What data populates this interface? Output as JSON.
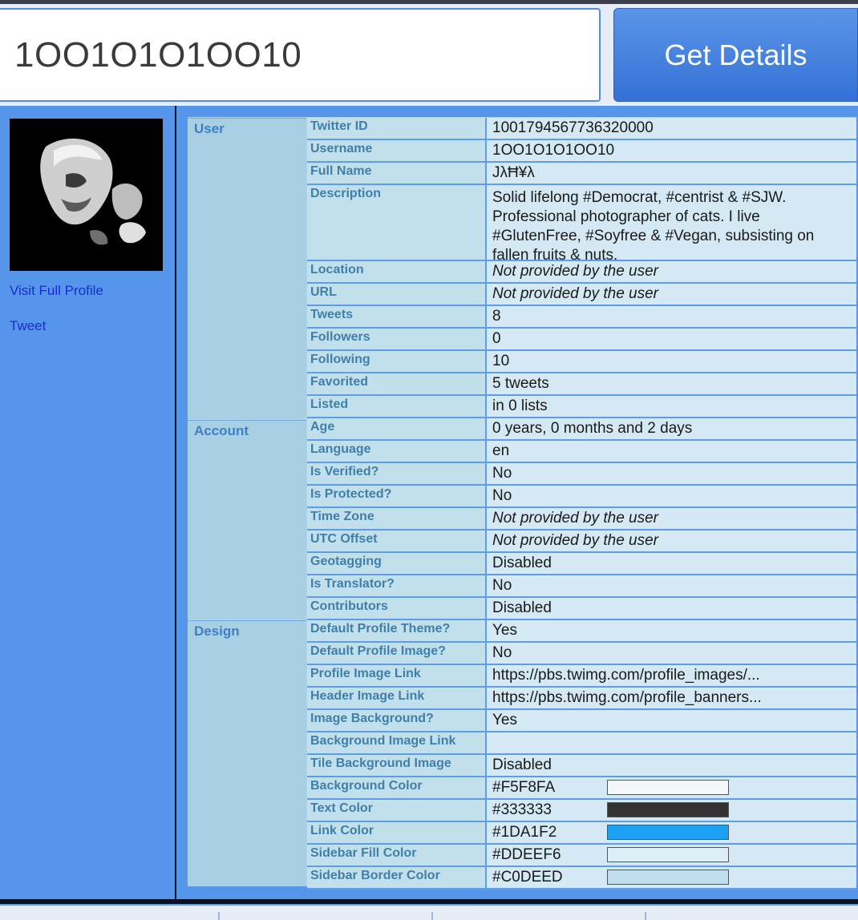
{
  "search": {
    "value": "1OO1O1O1OO10"
  },
  "get_details_label": "Get Details",
  "sidebar": {
    "visit_profile": "Visit Full Profile",
    "tweet": "Tweet"
  },
  "sections": {
    "user": "User",
    "account": "Account",
    "design": "Design"
  },
  "rows": [
    {
      "label": "Twitter ID",
      "value": "1001794567736320000"
    },
    {
      "label": "Username",
      "value": "1OO1O1O1OO10"
    },
    {
      "label": "Full Name",
      "value": "JλĦ¥λ"
    },
    {
      "label": "Description",
      "value": "Solid lifelong #Democrat, #centrist & #SJW. Professional photographer of cats. I live #GlutenFree, #Soyfree & #Vegan, subsisting on fallen fruits & nuts."
    },
    {
      "label": "Location",
      "value": "Not provided by the user"
    },
    {
      "label": "URL",
      "value": "Not provided by the user"
    },
    {
      "label": "Tweets",
      "value": "8"
    },
    {
      "label": "Followers",
      "value": "0"
    },
    {
      "label": "Following",
      "value": "10"
    },
    {
      "label": "Favorited",
      "value": "5 tweets"
    },
    {
      "label": "Listed",
      "value": "in 0 lists"
    },
    {
      "label": "Age",
      "value": "0 years, 0 months and 2 days"
    },
    {
      "label": "Language",
      "value": "en"
    },
    {
      "label": "Is Verified?",
      "value": "No"
    },
    {
      "label": "Is Protected?",
      "value": "No"
    },
    {
      "label": "Time Zone",
      "value": "Not provided by the user"
    },
    {
      "label": "UTC Offset",
      "value": "Not provided by the user"
    },
    {
      "label": "Geotagging",
      "value": "Disabled"
    },
    {
      "label": "Is Translator?",
      "value": "No"
    },
    {
      "label": "Contributors",
      "value": "Disabled"
    },
    {
      "label": "Default Profile Theme?",
      "value": "Yes"
    },
    {
      "label": "Default Profile Image?",
      "value": "No"
    },
    {
      "label": "Profile Image Link",
      "value": "https://pbs.twimg.com/profile_images/..."
    },
    {
      "label": "Header Image Link",
      "value": "https://pbs.twimg.com/profile_banners..."
    },
    {
      "label": "Image Background?",
      "value": "Yes"
    },
    {
      "label": "Background Image Link",
      "value": ""
    },
    {
      "label": "Tile Background Image",
      "value": "Disabled"
    },
    {
      "label": "Background Color",
      "value": "#F5F8FA",
      "swatch": "#F5F8FA"
    },
    {
      "label": "Text Color",
      "value": "#333333",
      "swatch": "#333333"
    },
    {
      "label": "Link Color",
      "value": "#1DA1F2",
      "swatch": "#1DA1F2"
    },
    {
      "label": "Sidebar Fill Color",
      "value": "#DDEEF6",
      "swatch": "#DDEEF6"
    },
    {
      "label": "Sidebar Border Color",
      "value": "#C0DEED",
      "swatch": "#C0DEED"
    }
  ]
}
